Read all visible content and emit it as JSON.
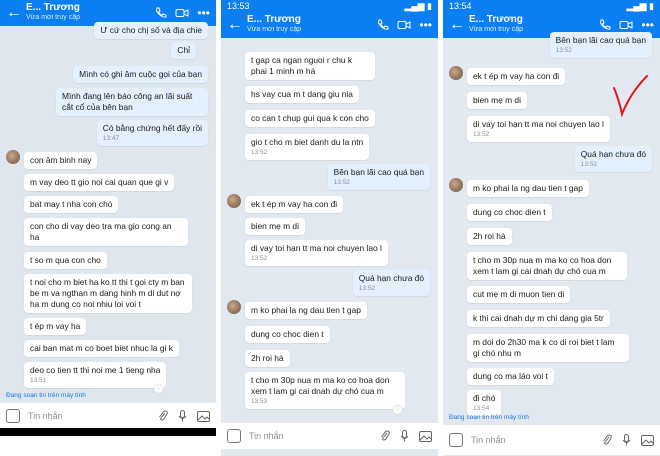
{
  "panels": [
    {
      "contact_name": "E... Trương",
      "contact_status": "Vừa mới truy cập",
      "messages": [
        {
          "dir": "out",
          "text": "Ư cứ cho chị số và địa chie"
        },
        {
          "dir": "out",
          "text": "Chỉ"
        },
        {
          "dir": "out",
          "text": "Mình có ghi âm cuộc gọi của bạn"
        },
        {
          "dir": "out",
          "text": "Mình đang lên báo công an lãi suất cắt cổ của bên bạn"
        },
        {
          "dir": "out",
          "text": "Có bằng chứng hết đấy rồi",
          "time": "13:47"
        },
        {
          "dir": "in",
          "text": "con âm binh nay"
        },
        {
          "dir": "in",
          "text": "m vay deo tt gio noi cai quan que gi v"
        },
        {
          "dir": "in",
          "text": "bat may t nha con chó"
        },
        {
          "dir": "in",
          "text": "con cho di vay deo tra ma gio cong an ha"
        },
        {
          "dir": "in",
          "text": "t so m qua con cho"
        },
        {
          "dir": "in",
          "text": "t noi cho m biet ha ko tt thi t goi cty m ban be m va ngthan m dang hinh m di dut nợ ha m dung co noi nhiu loi voi t"
        },
        {
          "dir": "in",
          "text": "t ép m vay ha"
        },
        {
          "dir": "in",
          "text": "cai ban mat m co boet biet nhuc la gi k"
        },
        {
          "dir": "in",
          "text": "deo co tien tt thi noi me 1 tieng nha",
          "time": "13:51"
        }
      ],
      "typing": "Đang soạn tin trên máy tính",
      "input_placeholder": "Tin nhắn",
      "time": ""
    },
    {
      "contact_name": "E... Trương",
      "contact_status": "Vừa mới truy cập",
      "time": "13:53",
      "messages": [
        {
          "dir": "in",
          "text": "t gap ca ngan nguoi r chu k phai 1 minh m há"
        },
        {
          "dir": "in",
          "text": "hs vay cua m t dang giu nia"
        },
        {
          "dir": "in",
          "text": "co can t chup gui qua k con cho"
        },
        {
          "dir": "in",
          "text": "gio t cho m biet danh du la ntn",
          "time": "13:52"
        },
        {
          "dir": "out",
          "text": "Bên bạn lãi cao quá bạn",
          "time": "13:52"
        },
        {
          "dir": "in",
          "text": "ek t ép m vay ha con đi"
        },
        {
          "dir": "in",
          "text": "bien mẹ m di"
        },
        {
          "dir": "in",
          "text": "di vay toi hạn tt ma noi chuyen lao l",
          "time": "13:52"
        },
        {
          "dir": "out",
          "text": "Quá hạn chưa đó",
          "time": "13:52"
        },
        {
          "dir": "in",
          "text": "m ko phai la ng dau tien t gap"
        },
        {
          "dir": "in",
          "text": "dung co choc dien t"
        },
        {
          "dir": "in",
          "text": "2h roi há"
        },
        {
          "dir": "in",
          "text": "t cho m 30p nua m ma ko co hoa don xem t lam gi cai dnah dự chó cua m",
          "time": "13:53"
        }
      ],
      "input_placeholder": "Tin nhắn"
    },
    {
      "contact_name": "E... Trương",
      "contact_status": "Vừa mới truy cập",
      "time": "13:54",
      "messages": [
        {
          "dir": "out",
          "text": "Bên bạn lãi cao quá bạn",
          "time": "13:52"
        },
        {
          "dir": "in",
          "text": "ek t ép m vay ha con đi"
        },
        {
          "dir": "in",
          "text": "bien mẹ m di"
        },
        {
          "dir": "in",
          "text": "di vay toi hạn tt ma noi chuyen lao l",
          "time": "13:52"
        },
        {
          "dir": "out",
          "text": "Quá hạn chưa đó",
          "time": "13:52"
        },
        {
          "dir": "in",
          "text": "m ko phai la ng dau tien t gap"
        },
        {
          "dir": "in",
          "text": "dung co choc dien t"
        },
        {
          "dir": "in",
          "text": "2h roi há"
        },
        {
          "dir": "in",
          "text": "t cho m 30p nua m ma ko co hoa don xem t lam gi cai dnah dự chó cua m"
        },
        {
          "dir": "in",
          "text": "cut mẹ m di muon tien di"
        },
        {
          "dir": "in",
          "text": "k thi cai dnah dự m chi dang gia 5tr"
        },
        {
          "dir": "in",
          "text": "m doi do 2h30 ma k co di roi biet t lam gi chó nhu m"
        },
        {
          "dir": "in",
          "text": "dung co ma láo voi t"
        },
        {
          "dir": "in",
          "text": "đi chó",
          "time": "13:54"
        }
      ],
      "typing": "Đang soạn tin trên máy tính",
      "input_placeholder": "Tin nhắn"
    }
  ],
  "colors": {
    "header": "#0b7ff2",
    "chat_bg": "#dfe6ee",
    "outgoing": "#e3f0ff",
    "incoming": "#ffffff",
    "annotation": "#e0181b"
  },
  "icons": [
    "back-arrow-icon",
    "phone-icon",
    "video-icon",
    "more-icon",
    "emoji-icon",
    "attach-icon",
    "mic-icon",
    "image-icon",
    "checkmark-annotation"
  ]
}
